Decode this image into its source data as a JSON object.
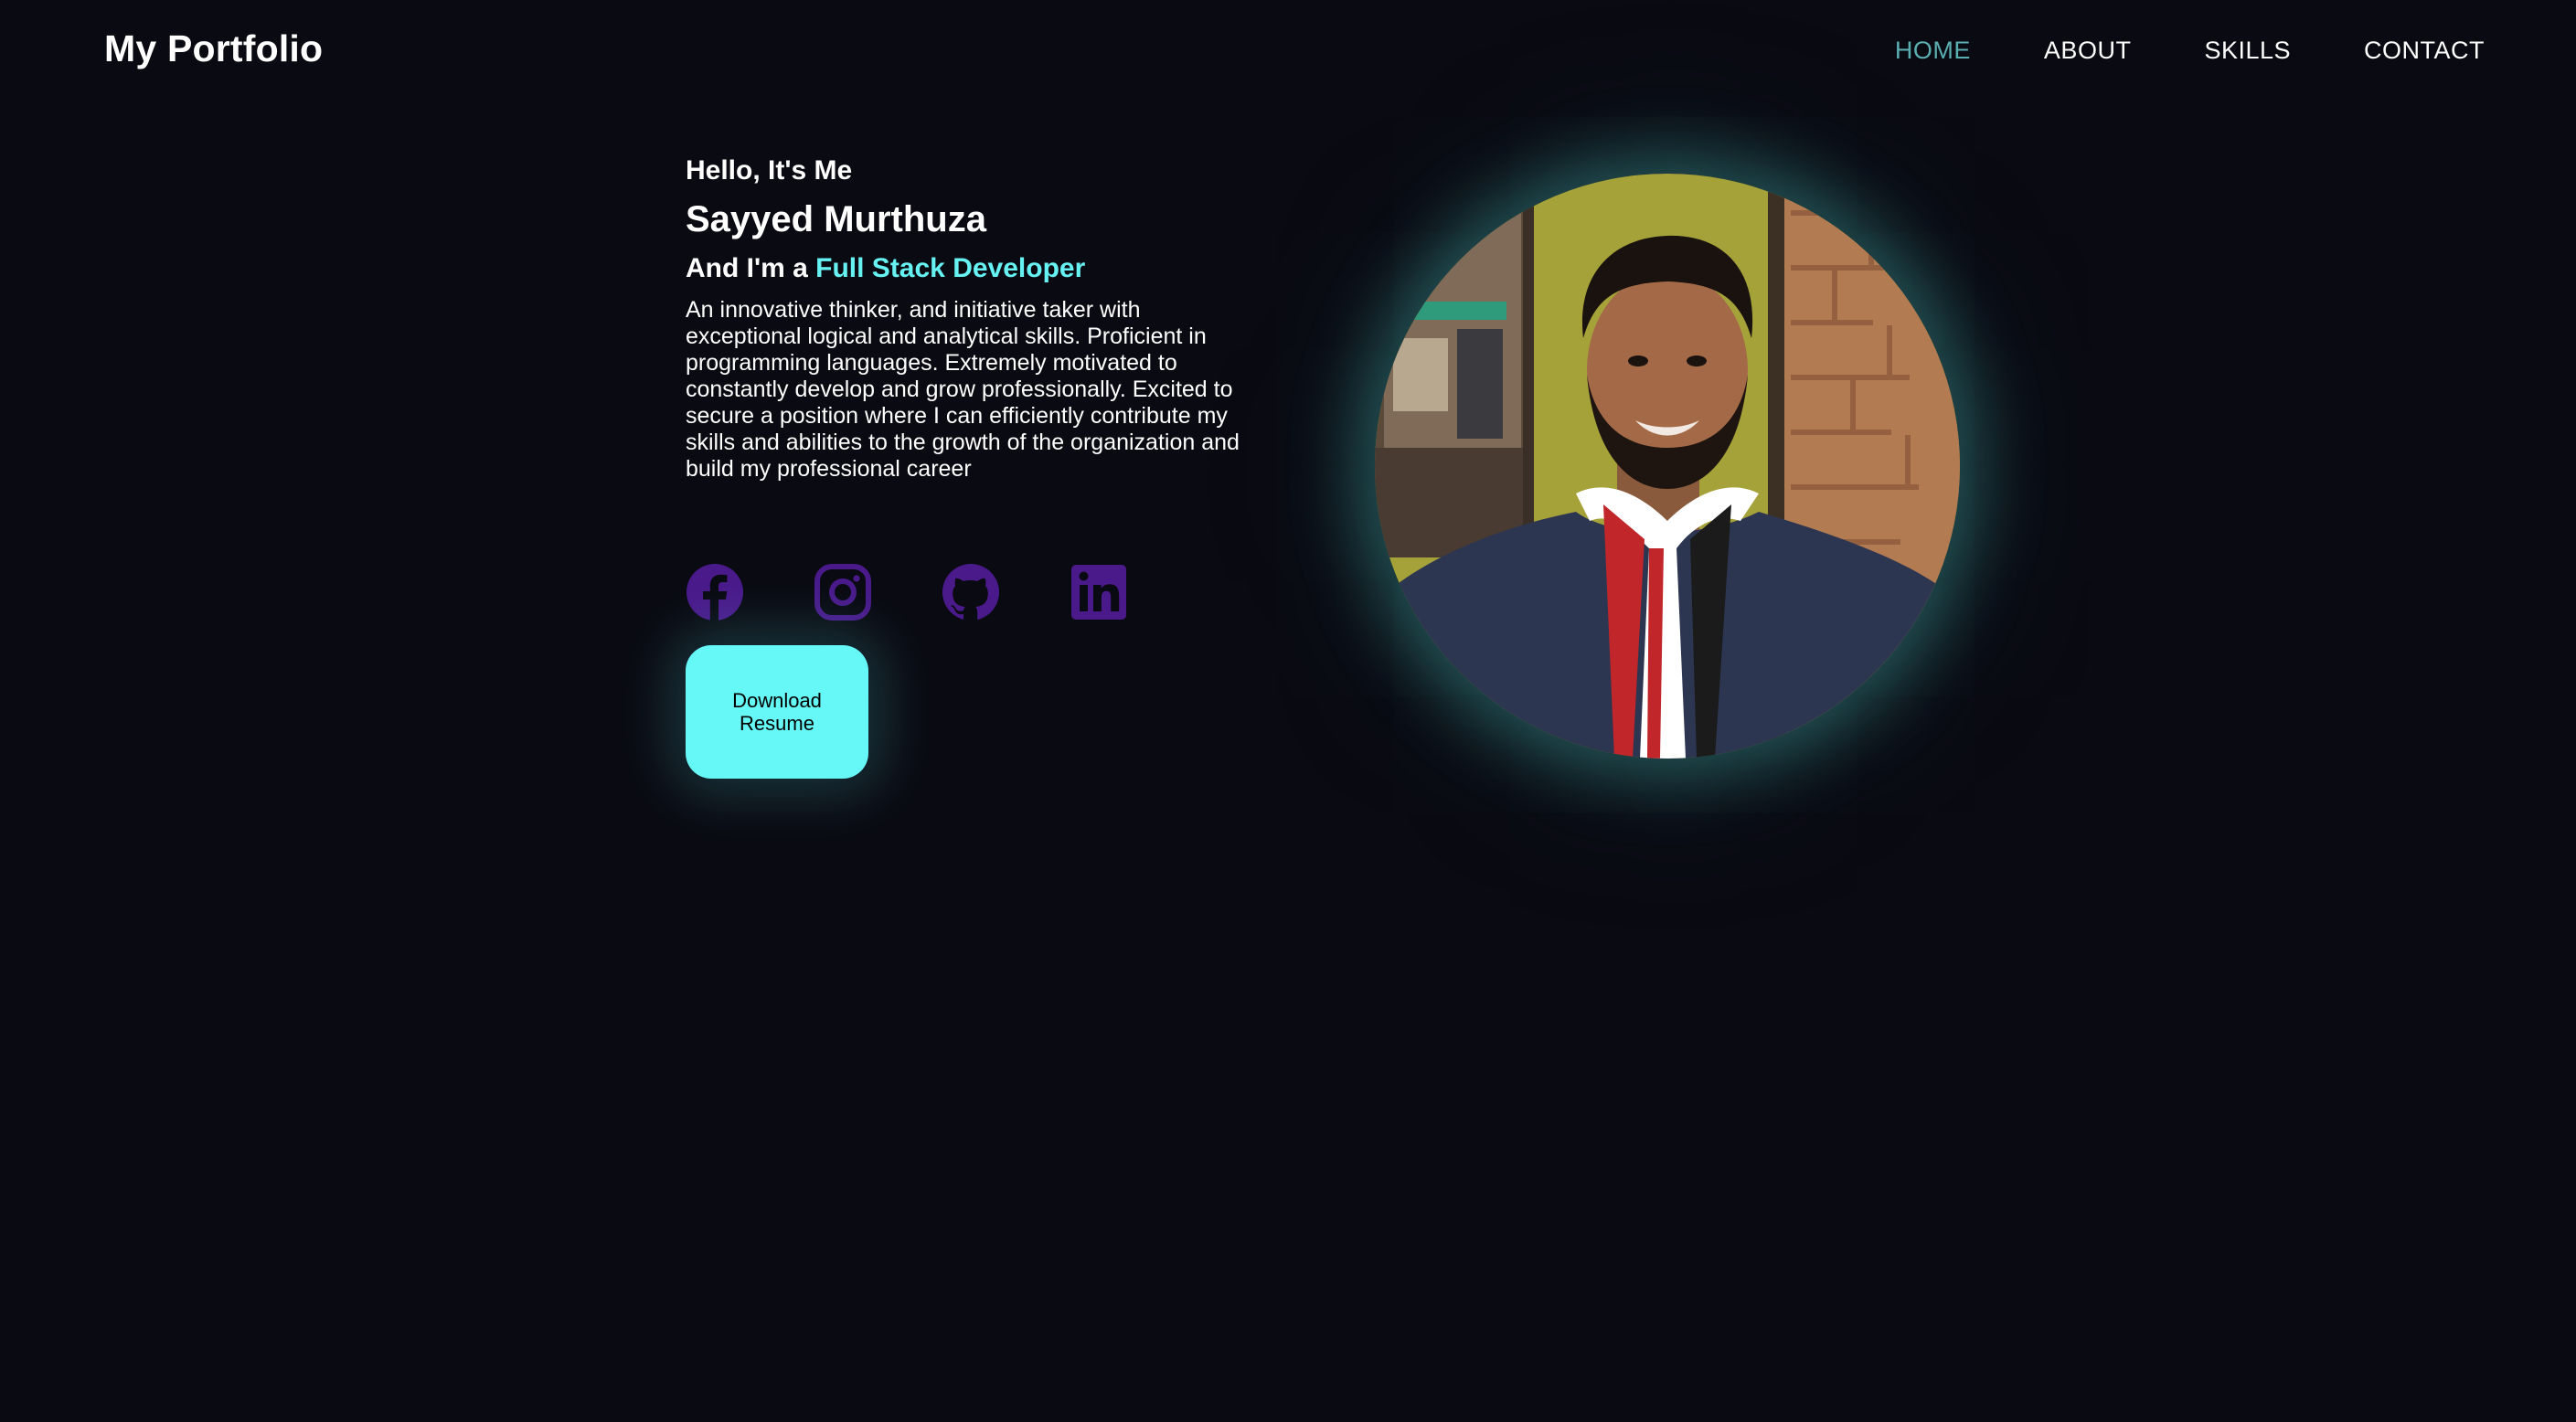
{
  "header": {
    "brand": "My Portfolio",
    "nav": [
      {
        "label": "HOME",
        "active": true
      },
      {
        "label": "ABOUT",
        "active": false
      },
      {
        "label": "SKILLS",
        "active": false
      },
      {
        "label": "CONTACT",
        "active": false
      }
    ]
  },
  "hero": {
    "greeting": "Hello, It's Me",
    "name": "Sayyed Murthuza",
    "role_prefix": "And I'm a ",
    "role_highlight": "Full Stack Developer",
    "bio": "An innovative thinker, and initiative taker with exceptional logical and analytical skills. Proficient in programming languages. Extremely motivated to constantly develop and grow professionally. Excited to secure a position where I can efficiently contribute my skills and abilities to the growth of the organization and build my professional career"
  },
  "socials": [
    {
      "icon": "facebook-icon"
    },
    {
      "icon": "instagram-icon"
    },
    {
      "icon": "github-icon"
    },
    {
      "icon": "linkedin-icon"
    }
  ],
  "download_button": {
    "label": "Download Resume"
  },
  "colors": {
    "background": "#0a0a12",
    "accent": "#66f2f2",
    "active_nav": "#5aaeb0",
    "icon": "#4a1a8a",
    "button": "#66f7f7"
  }
}
